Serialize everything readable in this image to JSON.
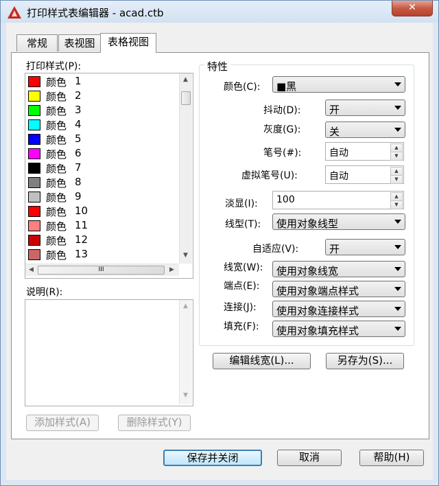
{
  "window": {
    "title": "打印样式表编辑器 - acad.ctb",
    "close_label": "✕"
  },
  "tabs": [
    {
      "label": "常规"
    },
    {
      "label": "表视图"
    },
    {
      "label": "表格视图"
    }
  ],
  "styles_list": {
    "label": "打印样式(P):",
    "items": [
      {
        "name": "颜色",
        "num": "1",
        "color": "#ff0000"
      },
      {
        "name": "颜色",
        "num": "2",
        "color": "#ffff00"
      },
      {
        "name": "颜色",
        "num": "3",
        "color": "#00ff00"
      },
      {
        "name": "颜色",
        "num": "4",
        "color": "#00ffff"
      },
      {
        "name": "颜色",
        "num": "5",
        "color": "#0000ff"
      },
      {
        "name": "颜色",
        "num": "6",
        "color": "#ff00ff"
      },
      {
        "name": "颜色",
        "num": "7",
        "color": "#000000"
      },
      {
        "name": "颜色",
        "num": "8",
        "color": "#808080"
      },
      {
        "name": "颜色",
        "num": "9",
        "color": "#c0c0c0"
      },
      {
        "name": "颜色",
        "num": "10",
        "color": "#ff0000"
      },
      {
        "name": "颜色",
        "num": "11",
        "color": "#ff7f7f"
      },
      {
        "name": "颜色",
        "num": "12",
        "color": "#cc0000"
      },
      {
        "name": "颜色",
        "num": "13",
        "color": "#cc6666"
      }
    ],
    "hscroll_thumb_label": "III"
  },
  "description": {
    "label": "说明(R):",
    "value": ""
  },
  "buttons": {
    "add_style": "添加样式(A)",
    "delete_style": "删除样式(Y)",
    "edit_lineweights": "编辑线宽(L)...",
    "save_as": "另存为(S)...",
    "save_close": "保存并关闭",
    "cancel": "取消",
    "help": "帮助(H)"
  },
  "properties": {
    "title": "特性",
    "color": {
      "label": "颜色(C):",
      "value": "■黑"
    },
    "dither": {
      "label": "抖动(D):",
      "value": "开"
    },
    "grayscale": {
      "label": "灰度(G):",
      "value": "关"
    },
    "pen_number": {
      "label": "笔号(#):",
      "value": "自动"
    },
    "virtual_pen": {
      "label": "虚拟笔号(U):",
      "value": "自动"
    },
    "screening": {
      "label": "淡显(I):",
      "value": "100"
    },
    "linetype": {
      "label": "线型(T):",
      "value": "使用对象线型"
    },
    "adaptive": {
      "label": "自适应(V):",
      "value": "开"
    },
    "lineweight": {
      "label": "线宽(W):",
      "value": "使用对象线宽"
    },
    "line_end": {
      "label": "端点(E):",
      "value": "使用对象端点样式"
    },
    "line_join": {
      "label": "连接(J):",
      "value": "使用对象连接样式"
    },
    "fill": {
      "label": "填充(F):",
      "value": "使用对象填充样式"
    }
  }
}
